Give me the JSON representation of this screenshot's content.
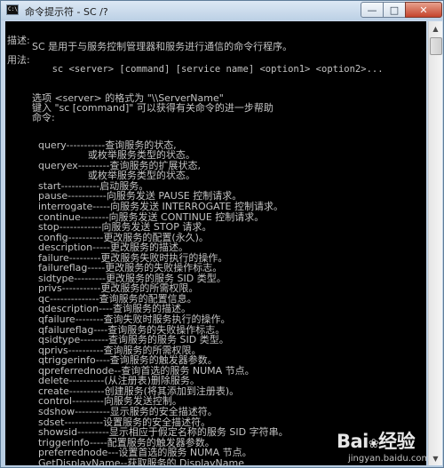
{
  "window": {
    "title": "命令提示符 - SC  /?",
    "icon_text": "C:\\",
    "controls": {
      "minimize": "—",
      "maximize": "□",
      "close": "✕"
    }
  },
  "console": {
    "lines": [
      {
        "text": "描述:",
        "zh": true
      },
      {
        "text": "        SC 是用于与服务控制管理器和服务进行通信的命令行程序。",
        "zh": true
      },
      {
        "text": "用法:",
        "zh": true
      },
      {
        "text": "        sc <server> [command] [service name] <option1> <option2>...",
        "zh": false
      },
      {
        "text": "        选项 <server> 的格式为 \"\\\\ServerName\"",
        "zh": true
      },
      {
        "text": "        键入 \"sc [command]\" 可以获得有关命令的进一步帮助",
        "zh": true
      },
      {
        "text": "        命令:",
        "zh": true
      },
      {
        "text": "          query-----------查询服务的状态,",
        "zh": true
      },
      {
        "text": "                          或枚举服务类型的状态。",
        "zh": true
      },
      {
        "text": "          queryex---------查询服务的扩展状态,",
        "zh": true
      },
      {
        "text": "                          或枚举服务类型的状态。",
        "zh": true
      },
      {
        "text": "          start-----------启动服务。",
        "zh": true
      },
      {
        "text": "          pause-----------向服务发送 PAUSE 控制请求。",
        "zh": true
      },
      {
        "text": "          interrogate-----向服务发送 INTERROGATE 控制请求。",
        "zh": true
      },
      {
        "text": "          continue--------向服务发送 CONTINUE 控制请求。",
        "zh": true
      },
      {
        "text": "          stop------------向服务发送 STOP 请求。",
        "zh": true
      },
      {
        "text": "          config----------更改服务的配置(永久)。",
        "zh": true
      },
      {
        "text": "          description-----更改服务的描述。",
        "zh": true
      },
      {
        "text": "          failure---------更改服务失败时执行的操作。",
        "zh": true
      },
      {
        "text": "          failureflag-----更改服务的失败操作标志。",
        "zh": true
      },
      {
        "text": "          sidtype---------更改服务的服务 SID 类型。",
        "zh": true
      },
      {
        "text": "          privs-----------更改服务的所需权限。",
        "zh": true
      },
      {
        "text": "          qc--------------查询服务的配置信息。",
        "zh": true
      },
      {
        "text": "          qdescription----查询服务的描述。",
        "zh": true
      },
      {
        "text": "          qfailure--------查询失败时服务执行的操作。",
        "zh": true
      },
      {
        "text": "          qfailureflag----查询服务的失败操作标志。",
        "zh": true
      },
      {
        "text": "          qsidtype--------查询服务的服务 SID 类型。",
        "zh": true
      },
      {
        "text": "          qprivs----------查询服务的所需权限。",
        "zh": true
      },
      {
        "text": "          qtriggerinfo----查询服务的触发器参数。",
        "zh": true
      },
      {
        "text": "          qpreferrednode--查询首选的服务 NUMA 节点。",
        "zh": true
      },
      {
        "text": "          delete----------(从注册表)删除服务。",
        "zh": true
      },
      {
        "text": "          create----------创建服务(将其添加到注册表)。",
        "zh": true
      },
      {
        "text": "          control---------向服务发送控制。",
        "zh": true
      },
      {
        "text": "          sdshow----------显示服务的安全描述符。",
        "zh": true
      },
      {
        "text": "          sdset-----------设置服务的安全描述符。",
        "zh": true
      },
      {
        "text": "          showsid---------显示相应于假定名称的服务 SID 字符串。",
        "zh": true
      },
      {
        "text": "          triggerinfo-----配置服务的触发器参数。",
        "zh": true
      },
      {
        "text": "          preferrednode---设置首选的服务 NUMA 节点。",
        "zh": true
      },
      {
        "text": "          GetDisplayName--获取服务的 DisplayName",
        "zh": true
      }
    ]
  },
  "scrollbar": {
    "up": "▲",
    "down": "▼"
  },
  "watermark": {
    "logo": "Bai",
    "logo_paw": "❀",
    "logo_suffix": "经验",
    "sub": "jingyan.baidu.com"
  }
}
